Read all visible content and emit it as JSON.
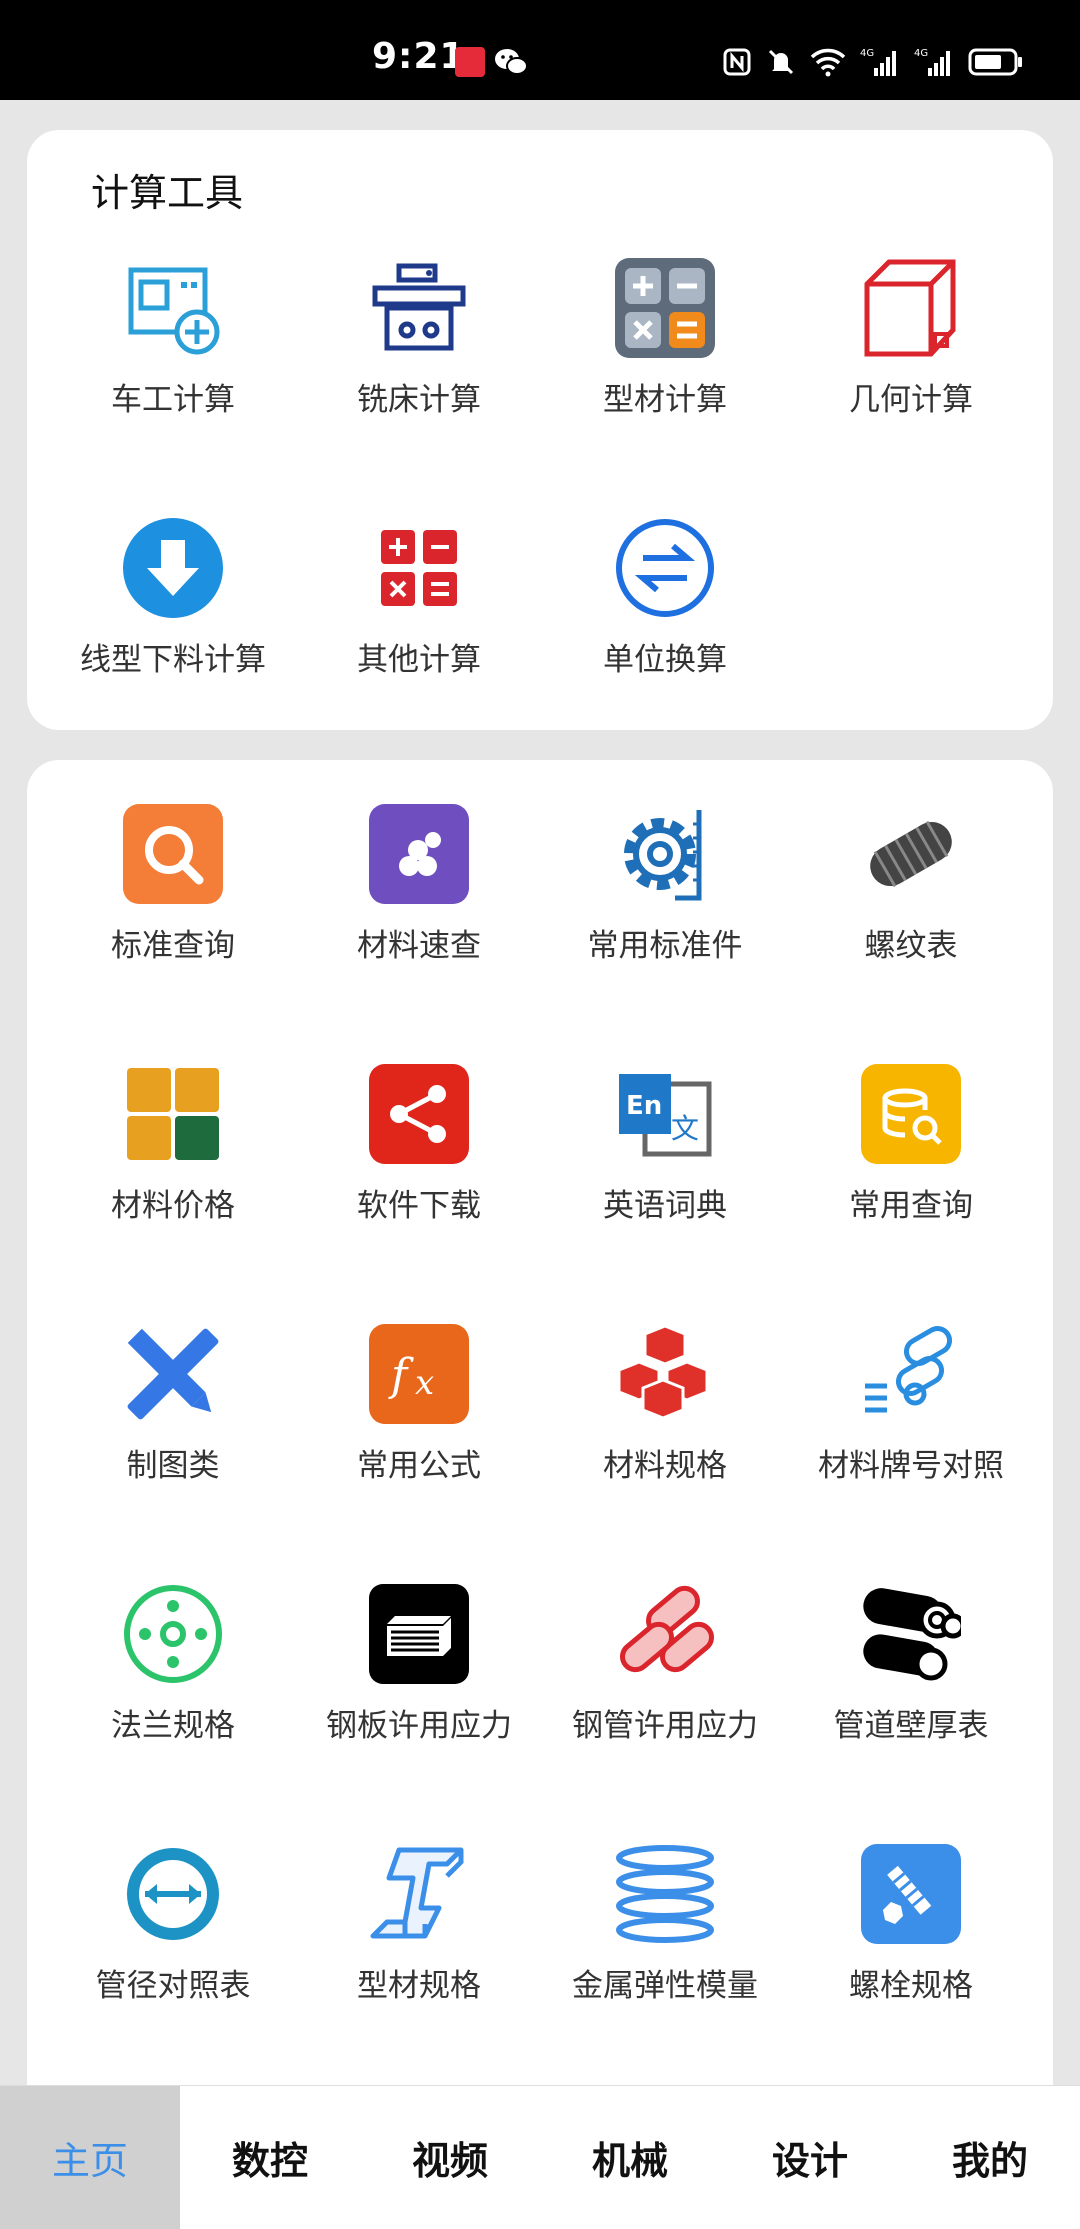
{
  "status": {
    "time": "9:21"
  },
  "calc_section": {
    "title": "计算工具",
    "items": [
      {
        "label": "车工计算",
        "icon": "lathe-icon"
      },
      {
        "label": "铣床计算",
        "icon": "milling-icon"
      },
      {
        "label": "型材计算",
        "icon": "calculator-icon"
      },
      {
        "label": "几何计算",
        "icon": "cube-icon"
      },
      {
        "label": "线型下料计算",
        "icon": "download-circle-icon"
      },
      {
        "label": "其他计算",
        "icon": "math-ops-icon"
      },
      {
        "label": "单位换算",
        "icon": "exchange-icon"
      }
    ]
  },
  "tools_section": {
    "items": [
      {
        "label": "标准查询",
        "icon": "search-icon"
      },
      {
        "label": "材料速查",
        "icon": "materials-icon"
      },
      {
        "label": "常用标准件",
        "icon": "gear-icon"
      },
      {
        "label": "螺纹表",
        "icon": "thread-icon"
      },
      {
        "label": "材料价格",
        "icon": "grid-icon"
      },
      {
        "label": "软件下载",
        "icon": "share-icon"
      },
      {
        "label": "英语词典",
        "icon": "translate-icon"
      },
      {
        "label": "常用查询",
        "icon": "database-search-icon"
      },
      {
        "label": "制图类",
        "icon": "pencil-ruler-icon"
      },
      {
        "label": "常用公式",
        "icon": "formula-icon"
      },
      {
        "label": "材料规格",
        "icon": "boxes-icon"
      },
      {
        "label": "材料牌号对照",
        "icon": "pipes-list-icon"
      },
      {
        "label": "法兰规格",
        "icon": "flange-icon"
      },
      {
        "label": "钢板许用应力",
        "icon": "steel-plate-icon"
      },
      {
        "label": "钢管许用应力",
        "icon": "steel-pipe-icon"
      },
      {
        "label": "管道壁厚表",
        "icon": "pipe-icon"
      },
      {
        "label": "管径对照表",
        "icon": "diameter-icon"
      },
      {
        "label": "型材规格",
        "icon": "ibeam-icon"
      },
      {
        "label": "金属弹性模量",
        "icon": "spring-icon"
      },
      {
        "label": "螺栓规格",
        "icon": "bolt-icon"
      }
    ]
  },
  "bottom_nav": [
    {
      "label": "主页",
      "active": true
    },
    {
      "label": "数控"
    },
    {
      "label": "视频"
    },
    {
      "label": "机械"
    },
    {
      "label": "设计"
    },
    {
      "label": "我的"
    }
  ],
  "colors": {
    "accent_blue": "#3b8fe8",
    "red": "#d9252b",
    "orange": "#f07a28"
  }
}
